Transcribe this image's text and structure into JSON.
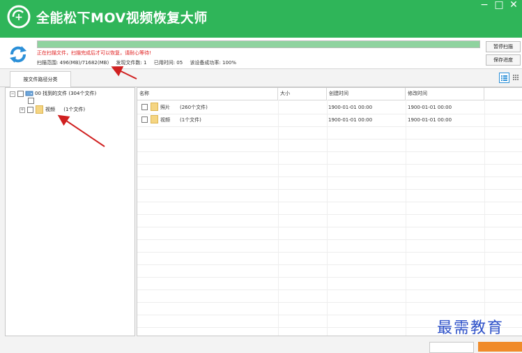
{
  "window": {
    "title": "全能松下MOV视频恢复大师",
    "controls": {
      "minimize": "−",
      "maximize": "□",
      "close": "✕"
    }
  },
  "scan": {
    "progress_percent": 100,
    "message": "正在扫描文件，扫描完成后才可以恢复，请耐心等待!",
    "range_label": "扫描范围: 496(MB)/71682(MB)",
    "found_label": "发现文件数: 1",
    "elapsed_label": "已用时间: 05",
    "success_label": "该设备成功率: 100%",
    "pause_button": "暂停扫描",
    "save_button": "保存进度"
  },
  "tabs": [
    {
      "label": "按文件路径分类"
    }
  ],
  "tree": {
    "root": {
      "label": "00 找到的文件  (304个文件)"
    },
    "children": [
      {
        "label": "视频",
        "count": "(1个文件)"
      }
    ]
  },
  "table": {
    "columns": [
      "名称",
      "大小",
      "创建时间",
      "修改时间"
    ],
    "rows": [
      {
        "name": "照片",
        "count": "(260个文件)",
        "size": "",
        "created": "1900-01-01 00:00",
        "modified": "1900-01-01 00:00"
      },
      {
        "name": "视频",
        "count": "(1个文件)",
        "size": "",
        "created": "1900-01-01 00:00",
        "modified": "1900-01-01 00:00"
      }
    ]
  },
  "watermark": "最需教育",
  "colors": {
    "titlebar": "#2fb559",
    "warning_text": "#e02020",
    "folder": "#f5d582",
    "arrow": "#d02020",
    "watermark": "#2f52c9",
    "accent_button": "#f08b2a"
  }
}
